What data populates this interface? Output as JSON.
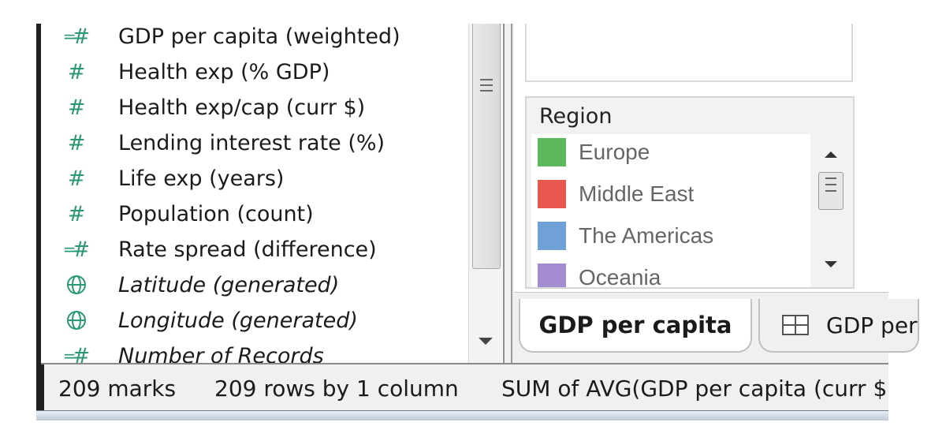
{
  "data_pane": {
    "fields": [
      {
        "label": "GDP per capita (weighted)",
        "icon": "calculated-measure-icon",
        "italic": false
      },
      {
        "label": "Health exp (% GDP)",
        "icon": "measure-icon",
        "italic": false
      },
      {
        "label": "Health exp/cap (curr $)",
        "icon": "measure-icon",
        "italic": false
      },
      {
        "label": "Lending interest rate (%)",
        "icon": "measure-icon",
        "italic": false
      },
      {
        "label": "Life exp (years)",
        "icon": "measure-icon",
        "italic": false
      },
      {
        "label": "Population (count)",
        "icon": "measure-icon",
        "italic": false
      },
      {
        "label": "Rate spread (difference)",
        "icon": "calculated-measure-icon",
        "italic": false
      },
      {
        "label": "Latitude (generated)",
        "icon": "globe-icon",
        "italic": true
      },
      {
        "label": "Longitude (generated)",
        "icon": "globe-icon",
        "italic": true
      },
      {
        "label": "Number of Records",
        "icon": "calculated-measure-icon",
        "italic": true
      }
    ]
  },
  "legend": {
    "title": "Region",
    "items": [
      {
        "label": "Europe",
        "color": "#5cb85c"
      },
      {
        "label": "Middle East",
        "color": "#e8584f"
      },
      {
        "label": "The Americas",
        "color": "#6fa0d8"
      },
      {
        "label": "Oceania",
        "color": "#a58cd0"
      }
    ]
  },
  "tabs": [
    {
      "label": "GDP per capita",
      "active": true
    },
    {
      "label": "GDP per",
      "active": false
    }
  ],
  "status": {
    "marks": "209 marks",
    "rows": "209 rows by 1 column",
    "sum": "SUM of AVG(GDP per capita (curr $"
  },
  "colors": {
    "field_icon": "#2a9a6e",
    "globe_icon": "#2a9a6e"
  }
}
